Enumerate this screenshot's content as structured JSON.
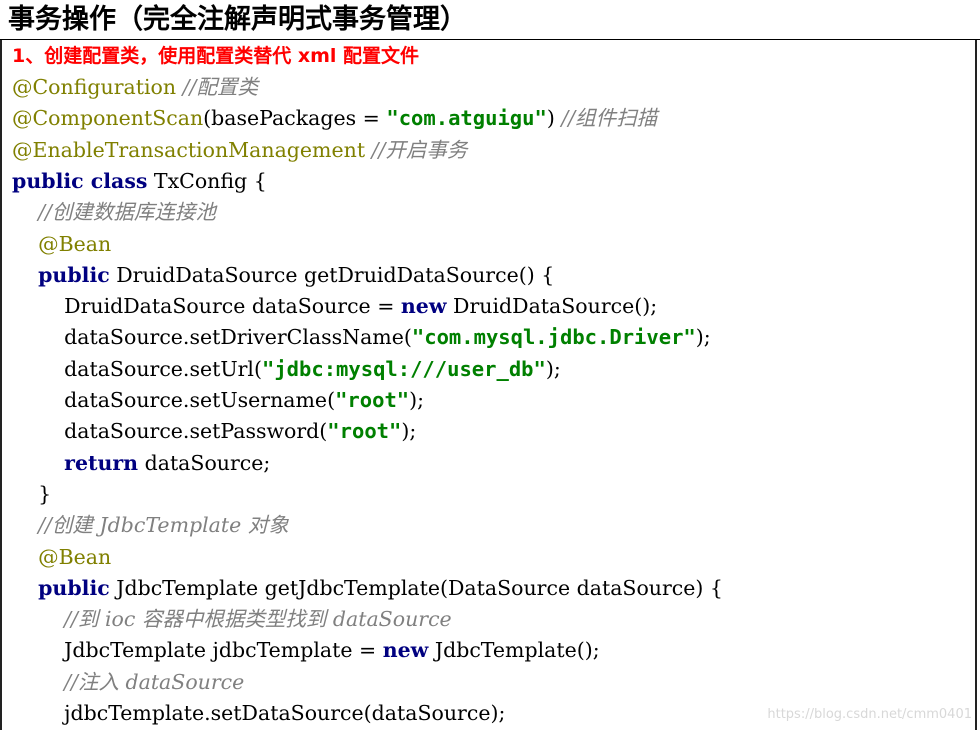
{
  "title": "事务操作（完全注解声明式事务管理）",
  "step_heading": "1、创建配置类，使用配置类替代 xml 配置文件",
  "code_lines": [
    [
      {
        "t": "ann",
        "v": "@Configuration"
      },
      {
        "t": "txt",
        "v": " "
      },
      {
        "t": "cmt",
        "v": "//配置类"
      }
    ],
    [
      {
        "t": "ann",
        "v": "@ComponentScan"
      },
      {
        "t": "txt",
        "v": "(basePackages = "
      },
      {
        "t": "str",
        "v": "\"com.atguigu\""
      },
      {
        "t": "txt",
        "v": ") "
      },
      {
        "t": "cmt",
        "v": "//组件扫描"
      }
    ],
    [
      {
        "t": "ann",
        "v": "@EnableTransactionManagement"
      },
      {
        "t": "txt",
        "v": " "
      },
      {
        "t": "cmt",
        "v": "//开启事务"
      }
    ],
    [
      {
        "t": "kw",
        "v": "public class"
      },
      {
        "t": "txt",
        "v": " TxConfig {"
      }
    ],
    [
      {
        "t": "txt",
        "v": "    "
      },
      {
        "t": "cmt",
        "v": "//创建数据库连接池"
      }
    ],
    [
      {
        "t": "txt",
        "v": "    "
      },
      {
        "t": "ann",
        "v": "@Bean"
      }
    ],
    [
      {
        "t": "txt",
        "v": "    "
      },
      {
        "t": "kw",
        "v": "public"
      },
      {
        "t": "txt",
        "v": " DruidDataSource getDruidDataSource() {"
      }
    ],
    [
      {
        "t": "txt",
        "v": "        DruidDataSource dataSource = "
      },
      {
        "t": "kw",
        "v": "new"
      },
      {
        "t": "txt",
        "v": " DruidDataSource();"
      }
    ],
    [
      {
        "t": "txt",
        "v": "        dataSource.setDriverClassName("
      },
      {
        "t": "str",
        "v": "\"com.mysql.jdbc.Driver\""
      },
      {
        "t": "txt",
        "v": ");"
      }
    ],
    [
      {
        "t": "txt",
        "v": "        dataSource.setUrl("
      },
      {
        "t": "str",
        "v": "\"jdbc:mysql:///user_db\""
      },
      {
        "t": "txt",
        "v": ");"
      }
    ],
    [
      {
        "t": "txt",
        "v": "        dataSource.setUsername("
      },
      {
        "t": "str",
        "v": "\"root\""
      },
      {
        "t": "txt",
        "v": ");"
      }
    ],
    [
      {
        "t": "txt",
        "v": "        dataSource.setPassword("
      },
      {
        "t": "str",
        "v": "\"root\""
      },
      {
        "t": "txt",
        "v": ");"
      }
    ],
    [
      {
        "t": "txt",
        "v": "        "
      },
      {
        "t": "kw",
        "v": "return"
      },
      {
        "t": "txt",
        "v": " dataSource;"
      }
    ],
    [
      {
        "t": "txt",
        "v": "    }"
      }
    ],
    [
      {
        "t": "txt",
        "v": "    "
      },
      {
        "t": "cmt",
        "v": "//创建 JdbcTemplate 对象"
      }
    ],
    [
      {
        "t": "txt",
        "v": "    "
      },
      {
        "t": "ann",
        "v": "@Bean"
      }
    ],
    [
      {
        "t": "txt",
        "v": "    "
      },
      {
        "t": "kw",
        "v": "public"
      },
      {
        "t": "txt",
        "v": " JdbcTemplate getJdbcTemplate(DataSource dataSource) {"
      }
    ],
    [
      {
        "t": "txt",
        "v": "        "
      },
      {
        "t": "cmt",
        "v": "//到 ioc 容器中根据类型找到 dataSource"
      }
    ],
    [
      {
        "t": "txt",
        "v": "        JdbcTemplate jdbcTemplate = "
      },
      {
        "t": "kw",
        "v": "new"
      },
      {
        "t": "txt",
        "v": " JdbcTemplate();"
      }
    ],
    [
      {
        "t": "txt",
        "v": "        "
      },
      {
        "t": "cmt",
        "v": "//注入 dataSource"
      }
    ],
    [
      {
        "t": "txt",
        "v": "        jdbcTemplate.setDataSource(dataSource);"
      }
    ]
  ],
  "watermark": "https://blog.csdn.net/cmm0401",
  "colors": {
    "annotation": "#808000",
    "comment": "#808080",
    "keyword": "#000080",
    "string": "#008000",
    "heading": "#ff0000"
  }
}
